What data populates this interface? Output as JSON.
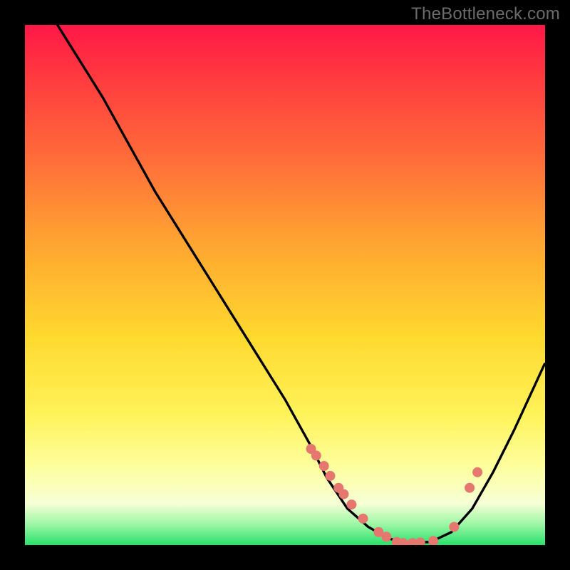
{
  "watermark": "TheBottleneck.com",
  "colors": {
    "dot": "#e6776f",
    "curve": "#000000",
    "gradient_top": "#ff1846",
    "gradient_bottom": "#28e06a"
  },
  "chart_data": {
    "type": "line",
    "title": "",
    "xlabel": "",
    "ylabel": "",
    "xlim": [
      0,
      100
    ],
    "ylim": [
      0,
      100
    ],
    "series": [
      {
        "name": "bottleneck-curve",
        "x": [
          0,
          5,
          10,
          15,
          20,
          25,
          30,
          35,
          40,
          45,
          50,
          55,
          58,
          62,
          66,
          70,
          74,
          78,
          82,
          86,
          90,
          94,
          100
        ],
        "values": [
          110,
          102,
          94,
          86,
          77,
          68,
          60,
          52,
          44,
          36,
          28,
          19,
          13,
          7,
          3.5,
          1.2,
          0.4,
          0.6,
          2.5,
          7,
          14,
          22,
          35
        ]
      }
    ],
    "scatter": [
      {
        "name": "highlight-points",
        "x": [
          55.0,
          56.0,
          57.5,
          58.7,
          60.3,
          61.3,
          62.8,
          65.0,
          68.0,
          69.5,
          71.5,
          72.7,
          74.5,
          76.0,
          78.5,
          82.5,
          85.5,
          87.0
        ],
        "values": [
          18.5,
          17.2,
          15.2,
          13.3,
          11.0,
          9.8,
          7.8,
          5.1,
          2.5,
          1.6,
          0.6,
          0.4,
          0.4,
          0.5,
          0.8,
          3.5,
          11.0,
          14.0
        ],
        "r": [
          7,
          7,
          7,
          7,
          7,
          7,
          7,
          7,
          7,
          7,
          7,
          7,
          7,
          7,
          7,
          7,
          7,
          7
        ]
      }
    ]
  }
}
